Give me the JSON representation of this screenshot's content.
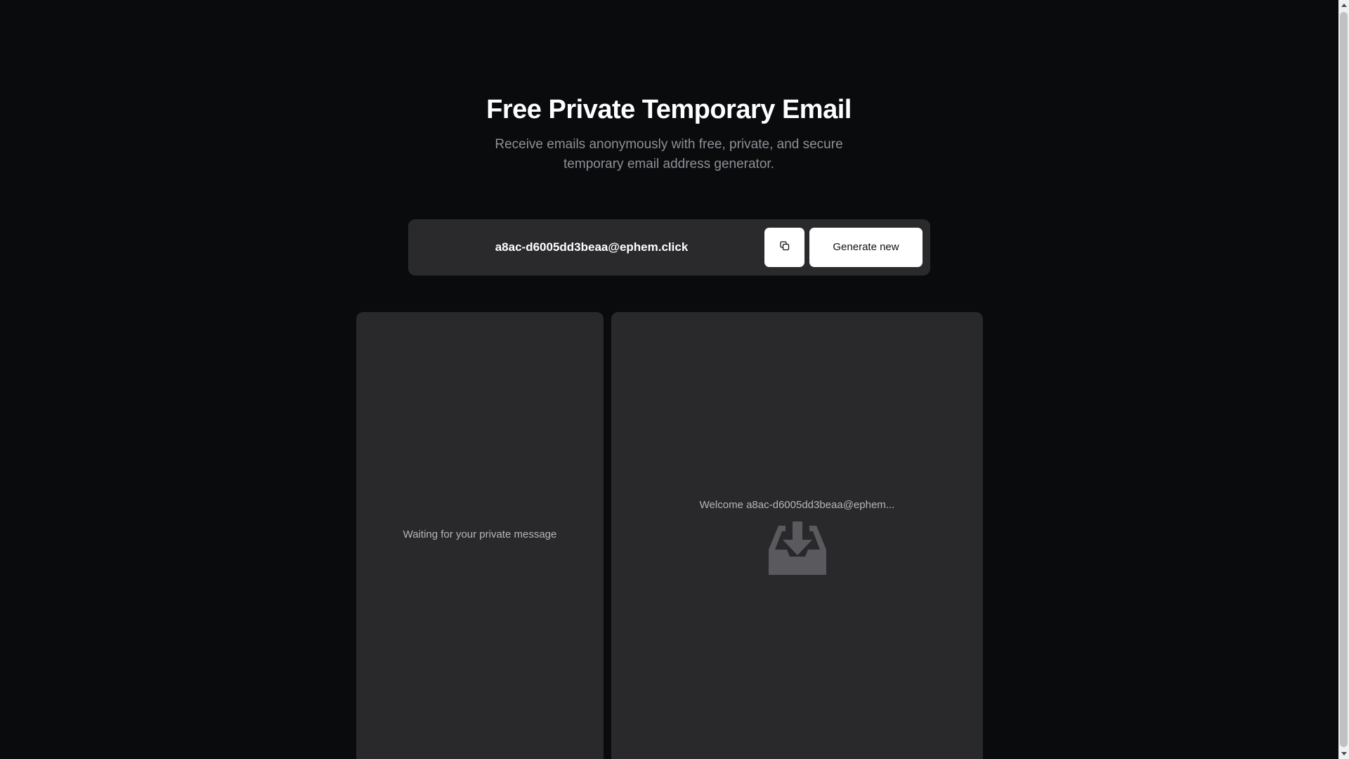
{
  "hero": {
    "title": "Free Private Temporary Email",
    "subtitle": "Receive emails anonymously with free, private, and secure temporary email address generator."
  },
  "email_bar": {
    "address": "a8ac-d6005dd3beaa@ephem.click",
    "copy_icon": "copy-icon",
    "generate_label": "Generate new"
  },
  "inbox": {
    "empty_message": "Waiting for your private message"
  },
  "reader": {
    "welcome": "Welcome a8ac-d6005dd3beaa@ephem...",
    "icon": "inbox-download-icon"
  },
  "colors": {
    "background": "#0a0b0d",
    "panel": "#29292c",
    "email_bar": "#2a2a2d",
    "button": "#ffffff",
    "muted_text": "#8d9096"
  }
}
